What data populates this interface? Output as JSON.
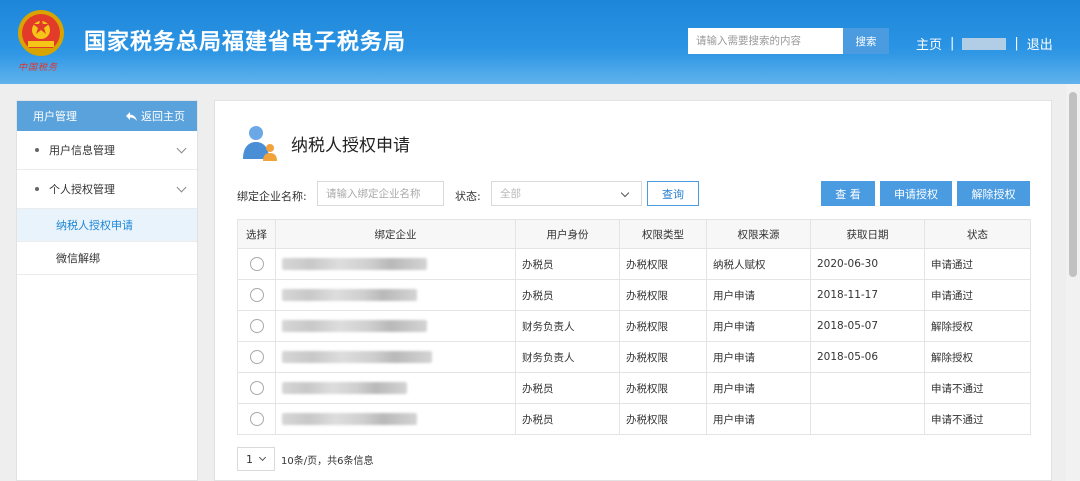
{
  "header": {
    "title": "国家税务总局福建省电子税务局",
    "emblem_script": "中国税务",
    "search": {
      "placeholder": "请输入需要搜索的内容",
      "button_label": "搜索"
    },
    "nav": {
      "home": "主页",
      "sep": "|",
      "logout": "退出"
    },
    "colors": {
      "bar": "#2a93e3",
      "search_button": "#4a9be0"
    }
  },
  "sidebar": {
    "header_title": "用户管理",
    "back_label": "返回主页",
    "items": [
      {
        "label": "用户信息管理"
      },
      {
        "label": "个人授权管理"
      }
    ],
    "subitems": [
      {
        "label": "纳税人授权申请",
        "active": true
      },
      {
        "label": "微信解绑",
        "active": false
      }
    ]
  },
  "main": {
    "title": "纳税人授权申请",
    "filters": {
      "company_label": "绑定企业名称:",
      "company_placeholder": "请输入绑定企业名称",
      "status_label": "状态:",
      "status_value": "全部",
      "query_label": "查询"
    },
    "actions": {
      "view": "查 看",
      "apply": "申请授权",
      "revoke": "解除授权"
    },
    "table": {
      "headers": [
        "选择",
        "绑定企业",
        "用户身份",
        "权限类型",
        "权限来源",
        "获取日期",
        "状态"
      ],
      "rows": [
        {
          "identity": "办税员",
          "perm_type": "办税权限",
          "source": "纳税人赋权",
          "date": "2020-06-30",
          "status": "申请通过"
        },
        {
          "identity": "办税员",
          "perm_type": "办税权限",
          "source": "用户申请",
          "date": "2018-11-17",
          "status": "申请通过"
        },
        {
          "identity": "财务负责人",
          "perm_type": "办税权限",
          "source": "用户申请",
          "date": "2018-05-07",
          "status": "解除授权"
        },
        {
          "identity": "财务负责人",
          "perm_type": "办税权限",
          "source": "用户申请",
          "date": "2018-05-06",
          "status": "解除授权"
        },
        {
          "identity": "办税员",
          "perm_type": "办税权限",
          "source": "用户申请",
          "date": "",
          "status": "申请不通过"
        },
        {
          "identity": "办税员",
          "perm_type": "办税权限",
          "source": "用户申请",
          "date": "",
          "status": "申请不通过"
        }
      ]
    },
    "pager": {
      "page_size": "1",
      "info": "10条/页，共6条信息"
    }
  }
}
